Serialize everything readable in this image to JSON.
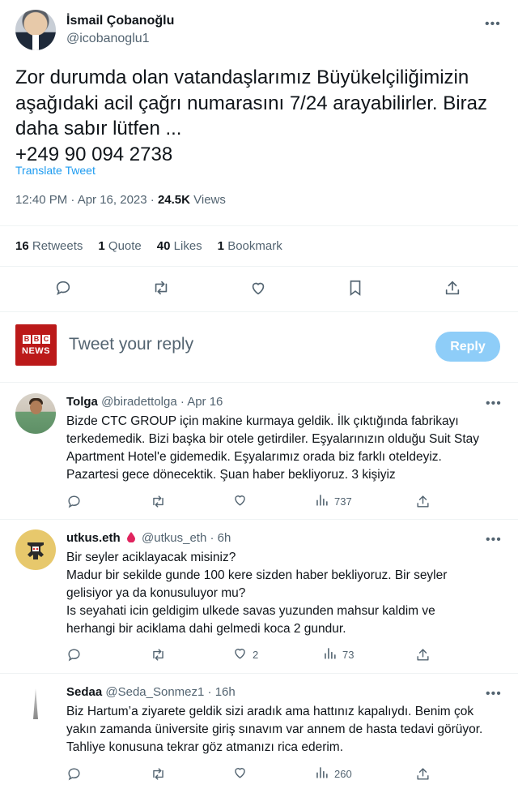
{
  "main_tweet": {
    "author_name": "İsmail Çobanoğlu",
    "author_handle": "@icobanoglu1",
    "text_lines": [
      "Zor durumda olan vatandaşlarımız Büyükelçiliğimizin",
      "aşağıdaki acil çağrı numarasını 7/24 arayabilirler. Biraz",
      "daha sabır lütfen ...",
      "+249 90 094 2738"
    ],
    "translate_label": "Translate Tweet",
    "timestamp": "12:40 PM · Apr 16, 2023 · ",
    "views_count": "24.5K",
    "views_label": " Views",
    "stats": {
      "retweets_count": "16",
      "retweets_label": "Retweets",
      "quotes_count": "1",
      "quotes_label": "Quote",
      "likes_count": "40",
      "likes_label": "Likes",
      "bookmarks_count": "1",
      "bookmarks_label": "Bookmark"
    },
    "actions": [
      "reply-icon",
      "retweet-icon",
      "like-icon",
      "bookmark-icon",
      "share-icon"
    ]
  },
  "reply_box": {
    "logo_letters": [
      "B",
      "B",
      "C"
    ],
    "logo_word": "NEWS",
    "placeholder": "Tweet your reply",
    "button_label": "Reply"
  },
  "replies": [
    {
      "name": "Tolga",
      "handle": "@biradettolga",
      "time": " · Apr 16",
      "lines": [
        "Bizde CTC GROUP için makine kurmaya geldik. İlk çıktığında fabrikayı",
        "terkedemedik. Bizi başka bir otele getirdiler. Eşyalarınızın olduğu Suit Stay",
        "Apartment Hotel'e gidemedik. Eşyalarımız orada biz farklı oteldeyiz.",
        "Pazartesi gece dönecektik. Şuan haber bekliyoruz. 3 kişiyiz"
      ],
      "likes": "",
      "views": "737"
    },
    {
      "name": "utkus.eth",
      "handle": "@utkus_eth",
      "time": " · 6h",
      "lines": [
        "Bir seyler aciklayacak misiniz?",
        "Madur bir sekilde gunde 100 kere sizden haber bekliyoruz. Bir seyler",
        "gelisiyor ya da konusuluyor mu?",
        "Is seyahati icin geldigim ulkede savas yuzunden mahsur kaldim ve",
        "herhangi bir aciklama dahi gelmedi koca 2 gundur."
      ],
      "likes": "2",
      "views": "73"
    },
    {
      "name": "Sedaa",
      "handle": "@Seda_Sonmez1",
      "time": " · 16h",
      "lines": [
        "Biz Hartum’a ziyarete geldik sizi aradık ama hattınız kapalıydı. Benim çok",
        "yakın zamanda üniversite giriş sınavım var annem de hasta tedavi görüyor.",
        "Tahliye konusuna tekrar göz atmanızı rica ederim."
      ],
      "likes": "",
      "views": "260"
    }
  ],
  "colors": {
    "text": "#0f1419",
    "secondary": "#536471",
    "link": "#1d9bf0",
    "reply_button": "#8ecdf8",
    "bbc_red": "#bb1919",
    "divider": "#eff3f4",
    "drop_red": "#e0245e"
  }
}
